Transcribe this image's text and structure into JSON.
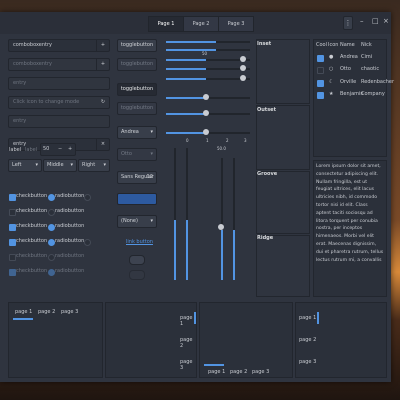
{
  "titlebar": {
    "tabs": [
      "Page 1",
      "Page 2",
      "Page 3"
    ],
    "menu_label": "⋮",
    "minimize_label": "–",
    "maximize_label": "□",
    "close_label": "×"
  },
  "left": {
    "combo_entry": "comboboxentry",
    "combo_entry_disabled": "comboboxentry",
    "entry_placeholder": "entry",
    "click_to_change": "Click icon to change mode",
    "entry_disabled": "entry",
    "entry_value": "entry",
    "clear_icon": "×",
    "add_icon": "+",
    "refresh_icon": "↻",
    "align": [
      "Left",
      "Middle",
      "Right"
    ],
    "label_text": "label",
    "label_dim": "label",
    "spin_value": "50",
    "spin_minus": "−",
    "spin_plus": "+",
    "check_label": "checkbutton",
    "radio_label": "radiobutton"
  },
  "middle": {
    "togglebutton": "togglebutton",
    "combo_andrea": "Andrea",
    "combo_otto": "Otto",
    "font_name": "Sans Regular",
    "font_size": "12",
    "none_label": "(None)",
    "link_label": "link button",
    "dropdown_icon": "▾"
  },
  "scales": {
    "value_50": "50",
    "value_500": "50.0",
    "ticks": [
      "0",
      "1",
      "2",
      "3"
    ]
  },
  "frames": {
    "inset": "Inset",
    "outset": "Outset",
    "groove": "Groove",
    "ridge": "Ridge"
  },
  "tree": {
    "headers": [
      "Cool",
      "Icon",
      "Name",
      "Nick"
    ],
    "rows": [
      {
        "cool": true,
        "icon": "●",
        "name": "Andrea",
        "nick": "Cimi"
      },
      {
        "cool": false,
        "icon": "○",
        "name": "Otto",
        "nick": "chaotic"
      },
      {
        "cool": true,
        "icon": "☾",
        "name": "Orville",
        "nick": "Redenbacher"
      },
      {
        "cool": true,
        "icon": "★",
        "name": "Benjamin",
        "nick": "Company"
      }
    ]
  },
  "lorem": "Lorem ipsum dolor sit amet, consectetur adipiscing elit. Nullam fringilla, est ut feugiat ultrices, elit lacus ultricies nibh, id commodo tortor nisi id elit. Class aptent taciti sociosqu ad litora torquent per conubia nostra, per inceptos himenaeos. Morbi vel elit erat. Maecenas dignissim, dui et pharetra rutrum, tellus lectus rutrum mi, a convallis",
  "notebooks": {
    "tabs": [
      "page 1",
      "page 2",
      "page 3"
    ]
  },
  "colors": {
    "accent": "#5294e2",
    "window_bg": "#2f343f",
    "text": "#c9ccd2"
  }
}
